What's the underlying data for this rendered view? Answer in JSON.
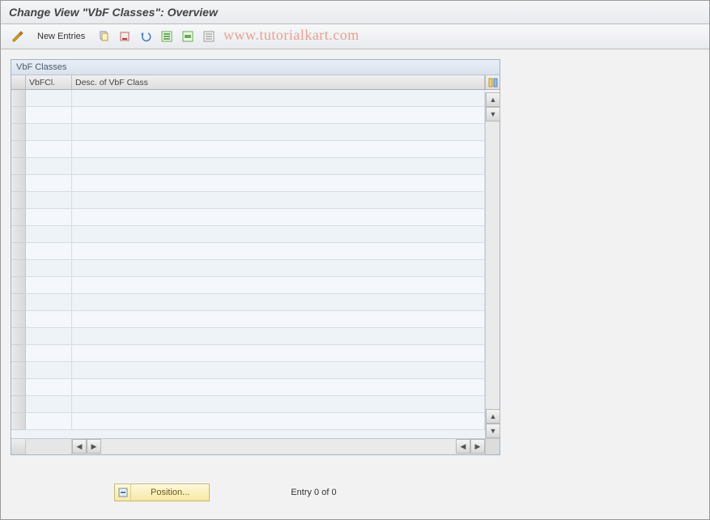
{
  "title": "Change View \"VbF Classes\": Overview",
  "toolbar": {
    "new_entries_label": "New Entries"
  },
  "watermark": "www.tutorialkart.com",
  "panel": {
    "title": "VbF Classes",
    "columns": {
      "vbfcl": "VbFCl.",
      "desc": "Desc. of VbF Class"
    },
    "rows": [
      {
        "vbfcl": "",
        "desc": ""
      },
      {
        "vbfcl": "",
        "desc": ""
      },
      {
        "vbfcl": "",
        "desc": ""
      },
      {
        "vbfcl": "",
        "desc": ""
      },
      {
        "vbfcl": "",
        "desc": ""
      },
      {
        "vbfcl": "",
        "desc": ""
      },
      {
        "vbfcl": "",
        "desc": ""
      },
      {
        "vbfcl": "",
        "desc": ""
      },
      {
        "vbfcl": "",
        "desc": ""
      },
      {
        "vbfcl": "",
        "desc": ""
      },
      {
        "vbfcl": "",
        "desc": ""
      },
      {
        "vbfcl": "",
        "desc": ""
      },
      {
        "vbfcl": "",
        "desc": ""
      },
      {
        "vbfcl": "",
        "desc": ""
      },
      {
        "vbfcl": "",
        "desc": ""
      },
      {
        "vbfcl": "",
        "desc": ""
      },
      {
        "vbfcl": "",
        "desc": ""
      },
      {
        "vbfcl": "",
        "desc": ""
      },
      {
        "vbfcl": "",
        "desc": ""
      },
      {
        "vbfcl": "",
        "desc": ""
      }
    ]
  },
  "footer": {
    "position_label": "Position...",
    "entry_status": "Entry 0 of 0"
  },
  "icons": {
    "toggle": "toggle-icon",
    "copy": "copy-icon",
    "delete": "delete-icon",
    "undo": "undo-icon",
    "select_all": "select-all-icon",
    "select_block": "select-block-icon",
    "deselect_all": "deselect-all-icon",
    "configure": "configure-columns-icon",
    "scroll_up": "▲",
    "scroll_down": "▼",
    "scroll_left": "◀",
    "scroll_right": "▶"
  }
}
